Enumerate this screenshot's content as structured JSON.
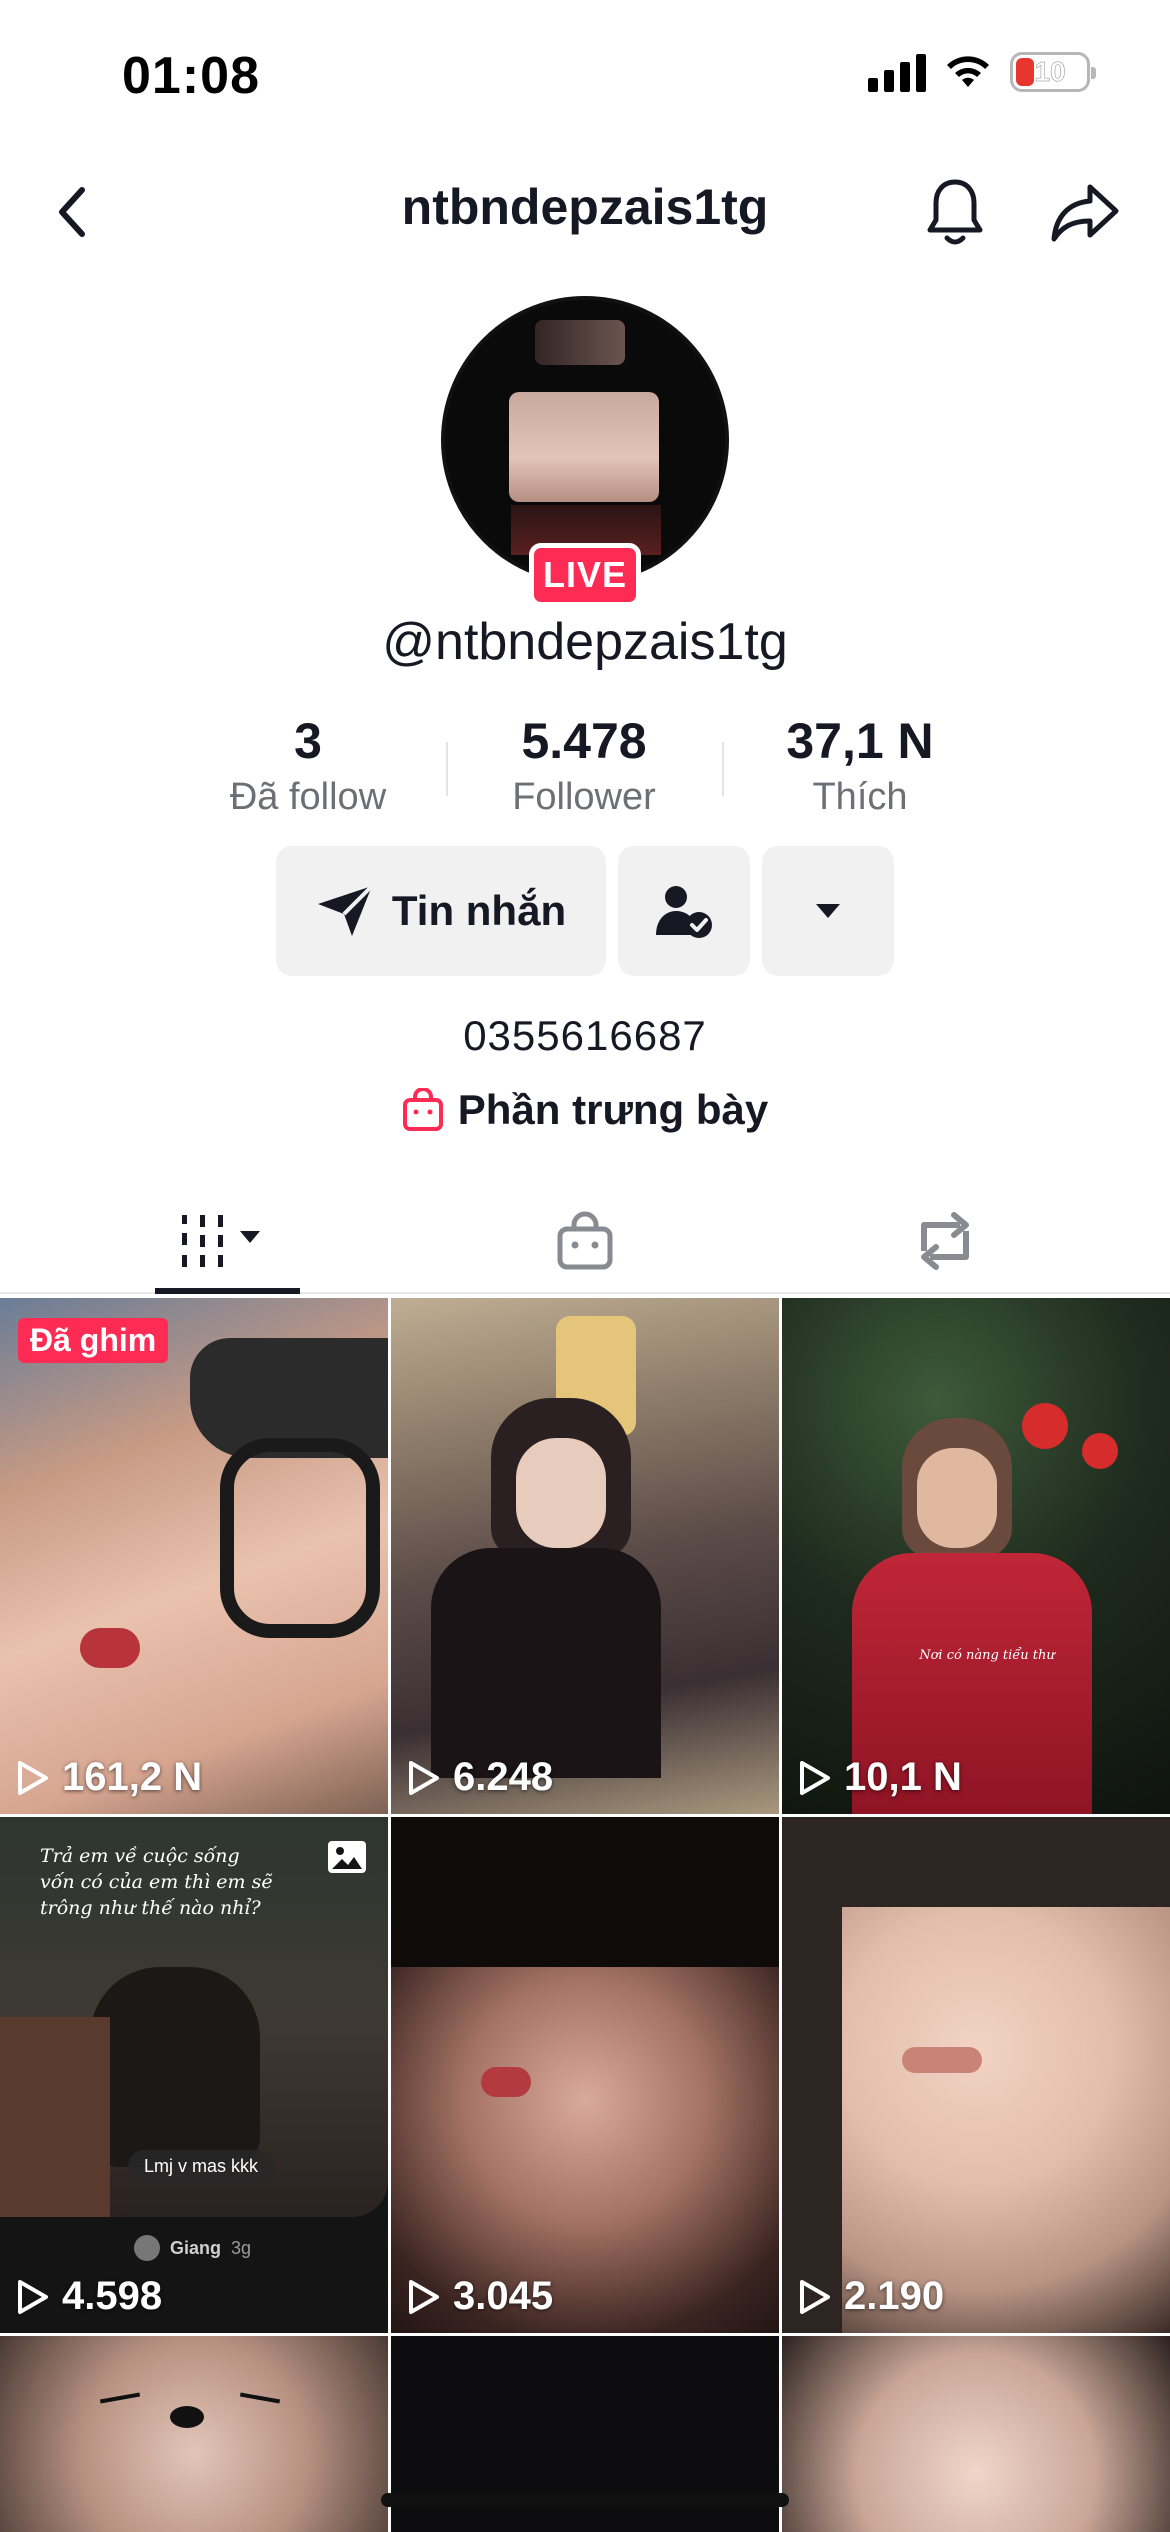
{
  "status_bar": {
    "time": "01:08",
    "battery": "10"
  },
  "header": {
    "title": "ntbndepzais1tg"
  },
  "profile": {
    "live_badge": "LIVE",
    "username": "@ntbndepzais1tg",
    "phone": "0355616687",
    "showcase_label": "Phần trưng bày"
  },
  "stats": [
    {
      "value": "3",
      "label": "Đã follow"
    },
    {
      "value": "5.478",
      "label": "Follower"
    },
    {
      "value": "37,1 N",
      "label": "Thích"
    }
  ],
  "actions": {
    "message_label": "Tin nhắn"
  },
  "tabs": [
    {
      "icon": "videos-grid-icon",
      "active": true
    },
    {
      "icon": "shopping-bag-icon",
      "active": false
    },
    {
      "icon": "repost-icon",
      "active": false
    }
  ],
  "videos": [
    {
      "views": "161,2 N",
      "pinned_label": "Đã ghim"
    },
    {
      "views": "6.248"
    },
    {
      "views": "10,1 N",
      "caption": "Nơi có nàng tiểu thư"
    },
    {
      "views": "4.598",
      "caption": "Trả em về cuộc sống vốn có của em thì em sẽ trông như thế nào nhỉ?",
      "inner_caption": "Lmj v mas kkk",
      "author": "Giang",
      "author_time": "3g"
    },
    {
      "views": "3.045"
    },
    {
      "views": "2.190"
    }
  ],
  "colors": {
    "accent": "#fe2c55",
    "text": "#161823",
    "muted": "#6e6f75",
    "button_bg": "#f1f1f2"
  }
}
